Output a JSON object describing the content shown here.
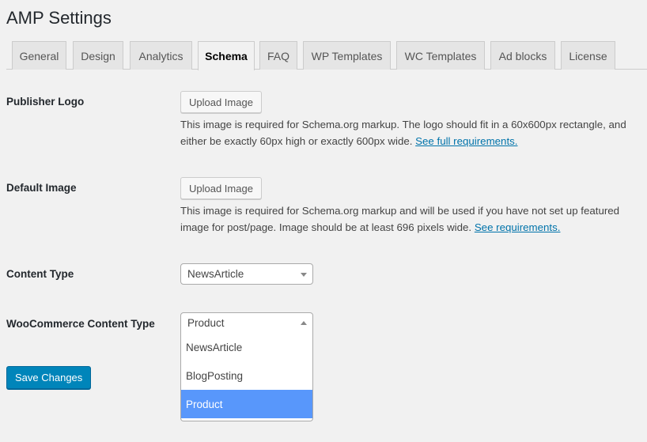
{
  "title": "AMP Settings",
  "tabs": [
    {
      "label": "General"
    },
    {
      "label": "Design"
    },
    {
      "label": "Analytics"
    },
    {
      "label": "Schema",
      "active": true
    },
    {
      "label": "FAQ"
    },
    {
      "label": "WP Templates"
    },
    {
      "label": "WC Templates"
    },
    {
      "label": "Ad blocks"
    },
    {
      "label": "License"
    }
  ],
  "publisher_logo": {
    "label": "Publisher Logo",
    "button": "Upload Image",
    "desc": "This image is required for Schema.org markup. The logo should fit in a 60x600px rectangle, and either be exactly 60px high or exactly 600px wide. ",
    "link": "See full requirements."
  },
  "default_image": {
    "label": "Default Image",
    "button": "Upload Image",
    "desc": "This image is required for Schema.org markup and will be used if you have not set up featured image for post/page. Image should be at least 696 pixels wide. ",
    "link": "See requirements."
  },
  "content_type": {
    "label": "Content Type",
    "value": "NewsArticle"
  },
  "wc_content_type": {
    "label": "WooCommerce Content Type",
    "value": "Product",
    "options": [
      "NewsArticle",
      "BlogPosting",
      "Product"
    ],
    "highlighted": "Product"
  },
  "save_label": "Save Changes",
  "colors": {
    "primary": "#0085ba",
    "highlight": "#5897fb",
    "link": "#0073aa"
  }
}
